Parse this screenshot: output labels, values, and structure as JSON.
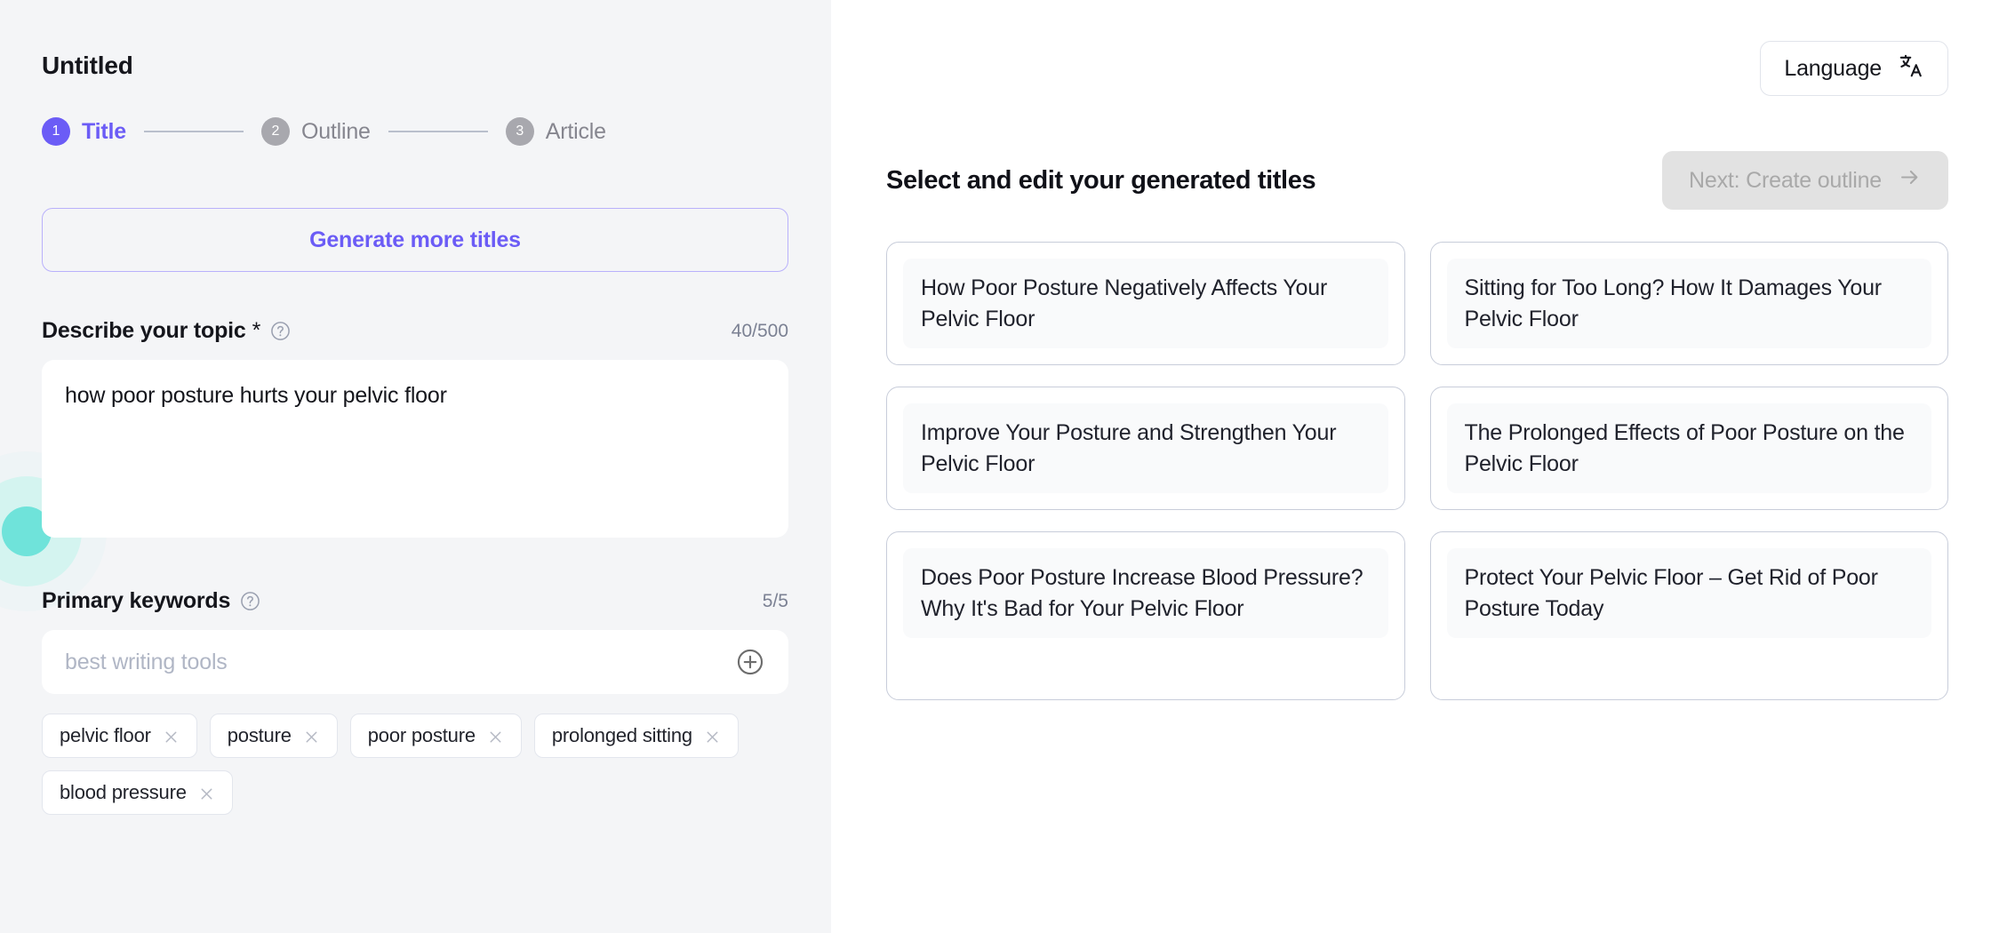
{
  "sidebar": {
    "doc_title": "Untitled",
    "stepper": [
      {
        "num": "1",
        "label": "Title",
        "state": "active"
      },
      {
        "num": "2",
        "label": "Outline",
        "state": "inactive"
      },
      {
        "num": "3",
        "label": "Article",
        "state": "inactive"
      }
    ],
    "generate_button": "Generate more titles",
    "topic": {
      "label": "Describe your topic",
      "required_mark": "*",
      "help_icon": "help-circle-icon",
      "counter": "40/500",
      "value": "how poor posture hurts your pelvic floor",
      "placeholder": ""
    },
    "keywords": {
      "label": "Primary keywords",
      "help_icon": "help-circle-icon",
      "counter": "5/5",
      "input_value": "",
      "input_placeholder": "best writing tools",
      "add_icon": "plus-circle-icon",
      "chips": [
        {
          "label": "pelvic floor",
          "remove_icon": "close-icon"
        },
        {
          "label": "posture",
          "remove_icon": "close-icon"
        },
        {
          "label": "poor posture",
          "remove_icon": "close-icon"
        },
        {
          "label": "prolonged sitting",
          "remove_icon": "close-icon"
        },
        {
          "label": "blood pressure",
          "remove_icon": "close-icon"
        }
      ]
    },
    "decoration_icon": "pulse-circle-decoration"
  },
  "main": {
    "language_button": {
      "label": "Language",
      "icon": "translate-icon"
    },
    "heading": "Select and edit your generated titles",
    "next_button": {
      "label": "Next: Create outline",
      "icon": "arrow-right-icon",
      "disabled": true
    },
    "titles": [
      "How Poor Posture Negatively Affects Your Pelvic Floor",
      "Sitting for Too Long? How It Damages Your Pelvic Floor",
      "Improve Your Posture and Strengthen Your Pelvic Floor",
      "The Prolonged Effects of Poor Posture on the Pelvic Floor",
      "Does Poor Posture Increase Blood Pressure? Why It's Bad for Your Pelvic Floor",
      "Protect Your Pelvic Floor – Get Rid of Poor Posture Today"
    ]
  },
  "colors": {
    "accent": "#6b5cf6",
    "sidebar_bg": "#f4f5f7",
    "main_bg": "#ffffff",
    "muted_text": "#86868f",
    "card_border": "#c8cdda",
    "disabled_btn_bg": "#e2e2e2",
    "decoration_teal": "#6fe3da"
  }
}
